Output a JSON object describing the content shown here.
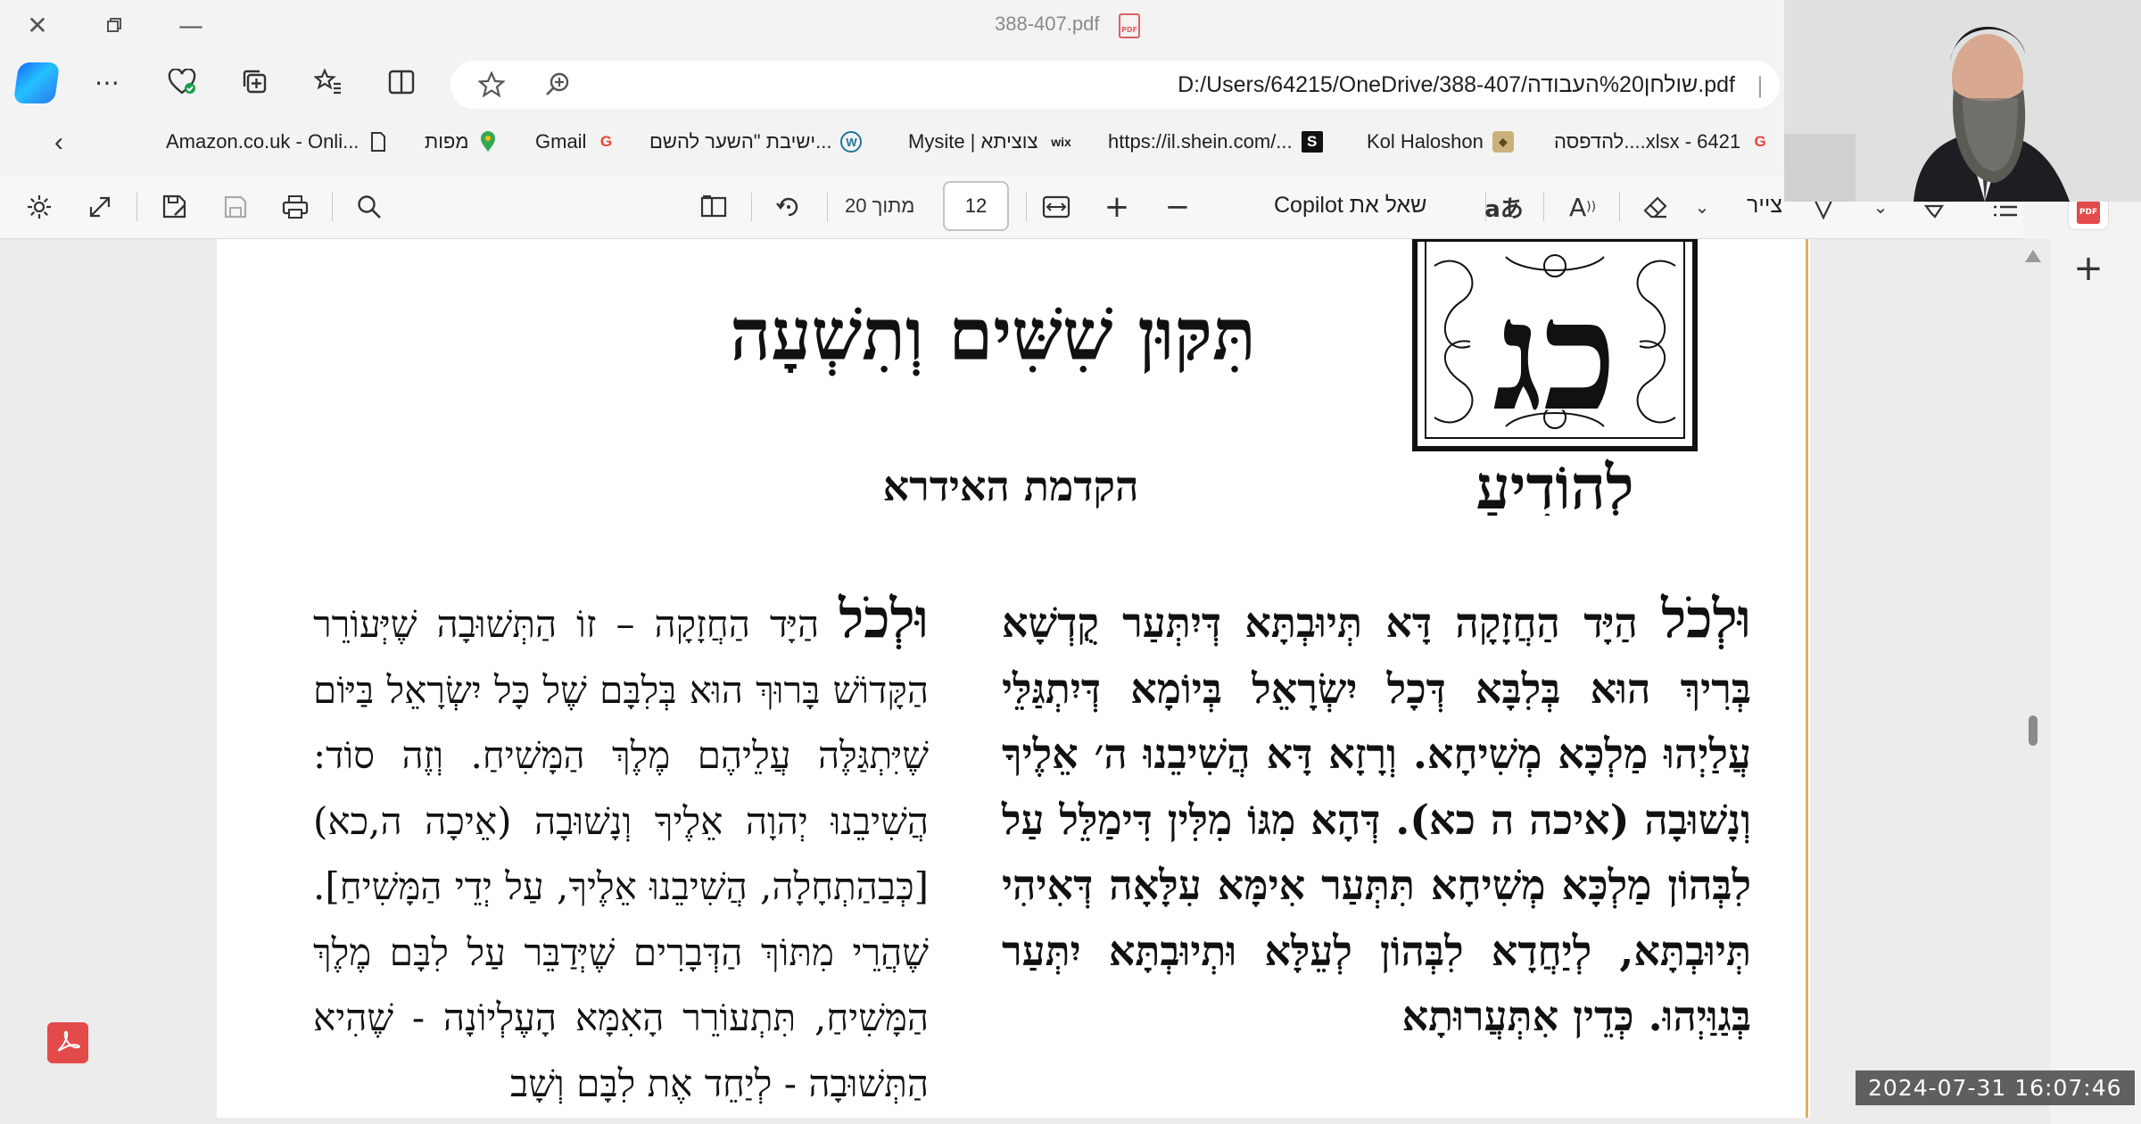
{
  "window": {
    "title": "388-407.pdf"
  },
  "addressbar": {
    "url": "D:/Users/64215/OneDrive/388-407/שולחן%20העבודה.pdf"
  },
  "favorites": [
    {
      "label": "Amazon.co.uk - Onli...",
      "icon": "page-icon"
    },
    {
      "label": "מפות",
      "icon": "maps-pin-icon"
    },
    {
      "label": "Gmail",
      "icon": "google-icon"
    },
    {
      "label": "ישיבת \"השער להשם...",
      "icon": "wordpress-icon"
    },
    {
      "label": "Mysite | צוציתא",
      "icon": "wix-icon"
    },
    {
      "label": "https://il.shein.com/...",
      "icon": "shein-icon"
    },
    {
      "label": "Kol Haloshon",
      "icon": "kol-haloshon-icon"
    },
    {
      "label": "להדפסה....xlsx - 6421",
      "icon": "google-icon"
    }
  ],
  "pdf_toolbar": {
    "page_current": "12",
    "page_of": "מתוך 20",
    "ask_copilot": "שאל את Copilot",
    "draw": "צייר"
  },
  "document": {
    "title": "תִּקּוּן שִׁשִּׁים וְתִשְׁעָה",
    "subtitle": "הקדמת האידרא",
    "emblem_letters": "כג",
    "emblem_word": "לְהוֹדִיעַ",
    "right_column": {
      "lead": "וּלְכֹל",
      "text": "הַיָּד הַחֲזָקָה דָּא תְּיוּבְתָּא דְּיִתְּעַר קֻדְשָׁא בְּרִיךְ הוּא בְּלִבָּא דְּכָל יִשְׂרָאֵל בְּיוֹמָא דְּיִתְגַּלֵּי עֲלַיְהוּ מַלְכָּא מְשִׁיחָא. וְרָזָא דָּא הֲשִׁיבֵנוּ ה׳ אֵלֶיךָ וְנָשׁוּבָה (איכה ה כא). דְּהָא מִגּוֹ מִלִּין דִּימַלֵּל עַל לִבְּהוֹן מַלְכָּא מְשִׁיחָא תִּתְּעַר אִימָּא עִלָּאָה דְּאִיהִי תְּיוּבְתָּא, לְיַחֲדָא לִבְּהוֹן לְעֵלָּא וּתְיוּבְתָּא יִתְּעַר בְּגַוַּיְהוּ. כְּדֵין אִתְּעֲרוּתָא"
    },
    "left_column": {
      "lead": "וּלְכֹל",
      "text": "הַיָּד הַחֲזָקָה – זוֹ הַתְּשׁוּבָה שֶׁיְּעוֹרֵר הַקָּדוֹשׁ בָּרוּךְ הוּא בְּלִבָּם שֶׁל כָּל יִשְׂרָאֵל בַּיּוֹם שֶׁיִּתְגַּלֶּה עֲלֵיהֶם מֶלֶךְ הַמָּשִׁיחַ. וְזֶה סוֹד: הֲשִׁיבֵנוּ יְהוָה אֵלֶיךָ וְנָשׁוּבָה (אֵיכָה ה,כא) [כְּבַהַתְחָלָה, הֲשִׁיבֵנוּ אֵלֶיךָ, עַל יְדֵי הַמָּשִׁיחַ]. שֶׁהֲרֵי מִתּוֹךְ הַדְּבָרִים שֶׁיְּדַבֵּר עַל לִבָּם מֶלֶךְ הַמָּשִׁיחַ, תִּתְעוֹרֵר הָאִמָּא הָעֶלְיוֹנָה - שֶׁהִיא הַתְּשׁוּבָה - לְיַחֵד אֶת לִבָּם וְשָׁב"
    }
  },
  "overlay": {
    "timestamp": "2024-07-31 16:07:46"
  },
  "colors": {
    "accent_blue": "#1a6dff",
    "pdf_red": "#e34a4a",
    "page_edge": "#d9b25e"
  }
}
